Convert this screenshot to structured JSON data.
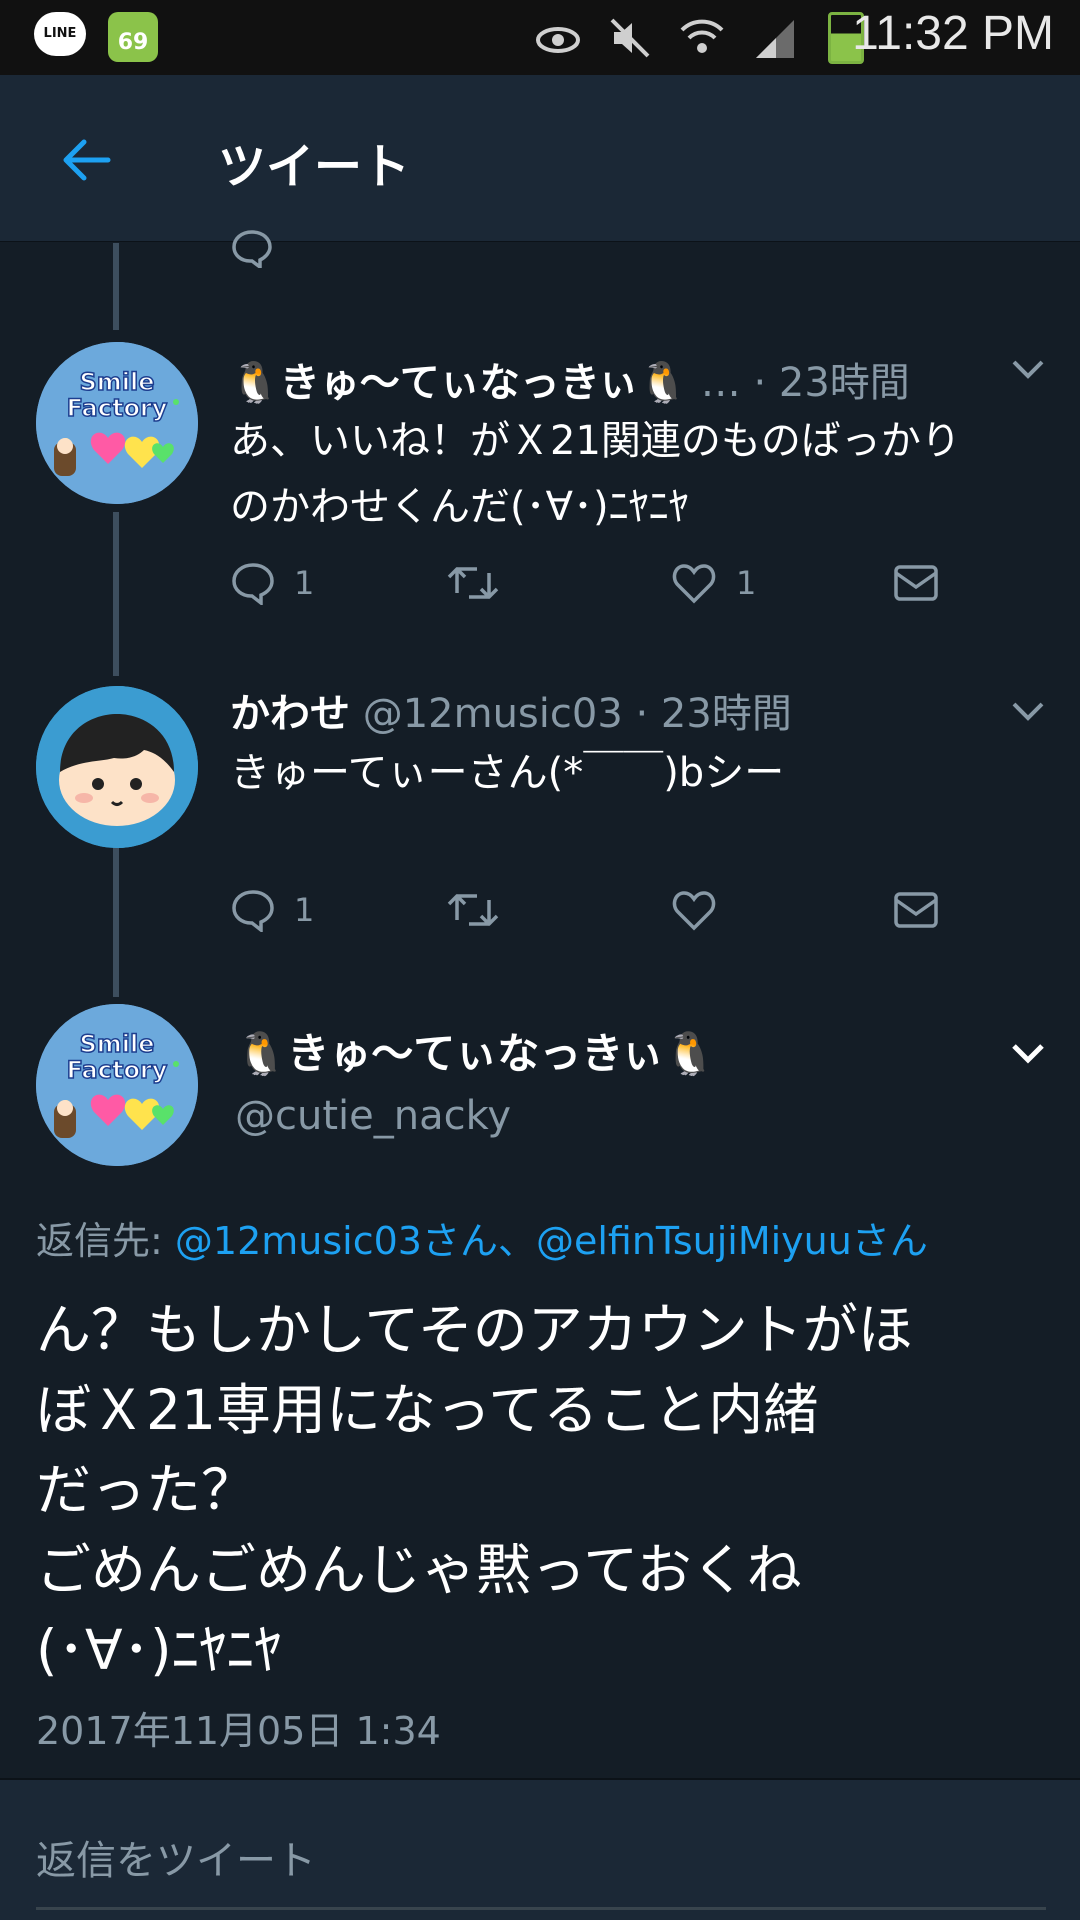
{
  "status_bar": {
    "line_label": "LINE",
    "notification_count": "69",
    "time": "11:32 PM",
    "battery_level": 0.6
  },
  "header": {
    "title": "ツイート"
  },
  "tweets": [
    {
      "name": "🐧きゅ〜てぃなっきぃ🐧",
      "name_suffix": "…",
      "time": "· 23時間",
      "text": "あ、いいね！がＸ21関連のものばっかり\nのかわせくんだ(･∀･)ﾆﾔﾆﾔ",
      "reply_count": "1",
      "retweet_count": "",
      "like_count": "1"
    },
    {
      "name": "かわせ",
      "handle": "@12music03",
      "time": "· 23時間",
      "text": "きゅーてぃーさん(*￣￣)bシー",
      "reply_count": "1",
      "retweet_count": "",
      "like_count": ""
    }
  ],
  "main_tweet": {
    "name": "🐧きゅ〜てぃなっきぃ🐧",
    "handle": "@cutie_nacky",
    "reply_to_label": "返信先:",
    "reply_to_mentions": "@12music03さん、@elfinTsujiMiyuuさん",
    "text": "ん？もしかしてそのアカウントがほ\nぼＸ21専用になってること内緒\nだった？\nごめんごめんじゃ黙っておくね\n(･∀･)ﾆﾔﾆﾔ",
    "date": "2017年11月05日 1:34"
  },
  "reply_box": {
    "placeholder": "返信をツイート"
  },
  "icons": {
    "back": "back-arrow-icon",
    "reply": "reply-icon",
    "retweet": "retweet-icon",
    "like": "heart-icon",
    "dm": "envelope-icon",
    "caret": "chevron-down-icon"
  },
  "colors": {
    "background": "#141d26",
    "header": "#1b2836",
    "accent": "#1da1f2",
    "secondary_text": "#8899a6"
  }
}
